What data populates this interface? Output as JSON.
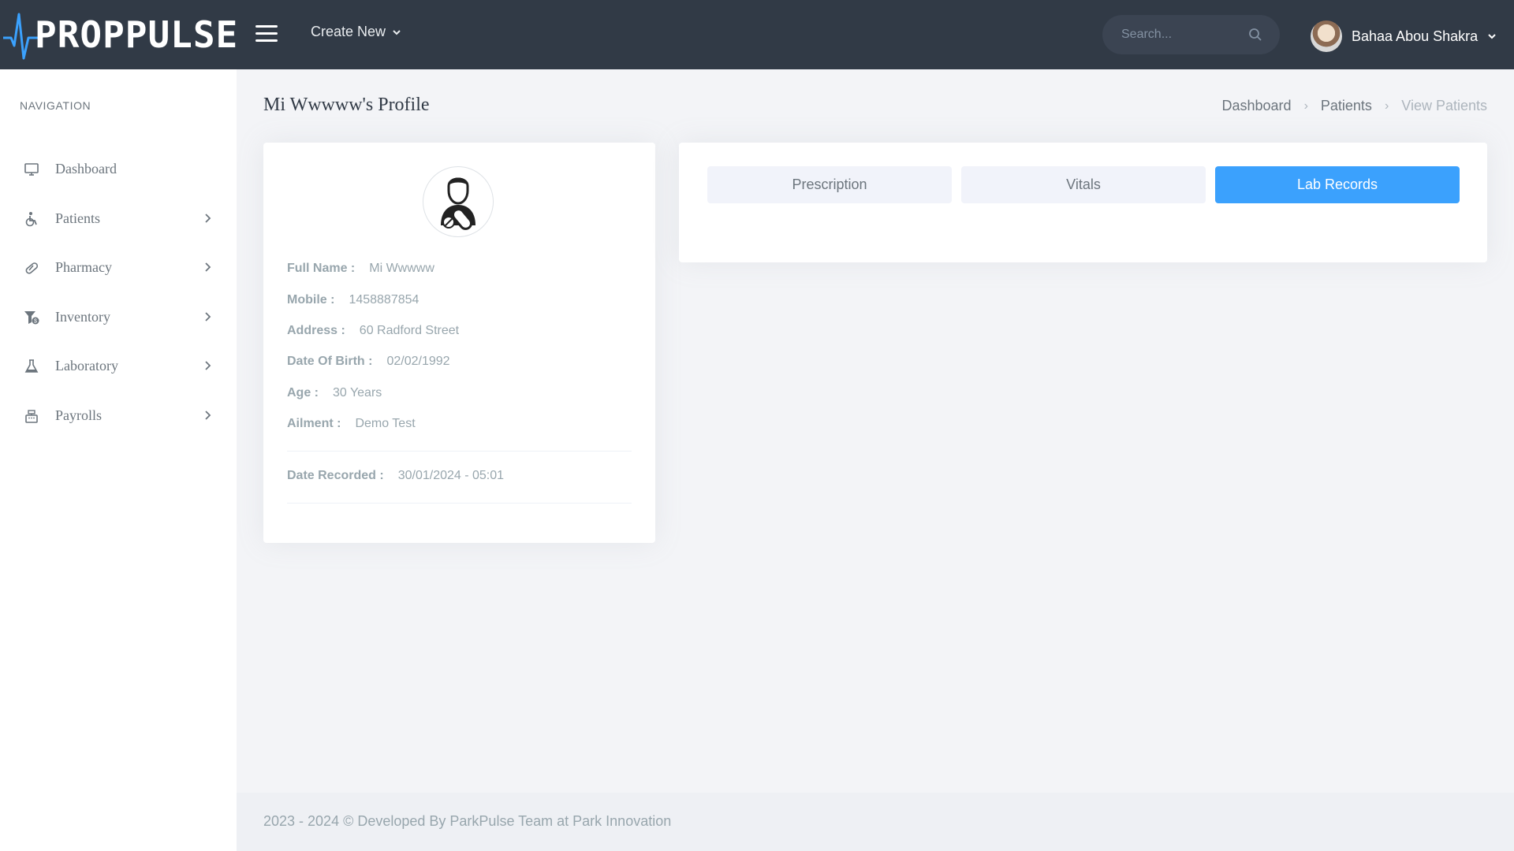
{
  "brand": {
    "logo_text": "PROPPULSE",
    "logo_accent_color": "#3ba1fd"
  },
  "header": {
    "create_new_label": "Create New",
    "search_placeholder": "Search...",
    "user_name": "Bahaa Abou Shakra"
  },
  "sidebar": {
    "title": "NAVIGATION",
    "items": [
      {
        "label": "Dashboard",
        "icon": "monitor-icon",
        "has_submenu": false
      },
      {
        "label": "Patients",
        "icon": "wheelchair-icon",
        "has_submenu": true
      },
      {
        "label": "Pharmacy",
        "icon": "pill-icon",
        "has_submenu": true
      },
      {
        "label": "Inventory",
        "icon": "funnel-dollar-icon",
        "has_submenu": true
      },
      {
        "label": "Laboratory",
        "icon": "flask-icon",
        "has_submenu": true
      },
      {
        "label": "Payrolls",
        "icon": "cash-register-icon",
        "has_submenu": true
      }
    ]
  },
  "page": {
    "title": "Mi Wwwww's Profile",
    "breadcrumb": [
      "Dashboard",
      "Patients",
      "View Patients"
    ]
  },
  "profile": {
    "avatar_icon": "patient-pill-icon",
    "fields": [
      {
        "label": "Full Name :",
        "value": "Mi Wwwww"
      },
      {
        "label": "Mobile :",
        "value": "1458887854"
      },
      {
        "label": "Address :",
        "value": "60 Radford Street"
      },
      {
        "label": "Date Of Birth :",
        "value": "02/02/1992"
      },
      {
        "label": "Age :",
        "value": "30 Years"
      },
      {
        "label": "Ailment :",
        "value": "Demo Test"
      }
    ],
    "date_recorded": {
      "label": "Date Recorded :",
      "value": "30/01/2024 - 05:01"
    }
  },
  "tabs": [
    {
      "label": "Prescription",
      "active": false
    },
    {
      "label": "Vitals",
      "active": false
    },
    {
      "label": "Lab Records",
      "active": true
    }
  ],
  "footer": {
    "text": "2023 - 2024 © Developed By ParkPulse Team at Park Innovation"
  },
  "colors": {
    "topbar": "#313a46",
    "primary": "#3ba1fd",
    "background": "#f3f4f7"
  }
}
